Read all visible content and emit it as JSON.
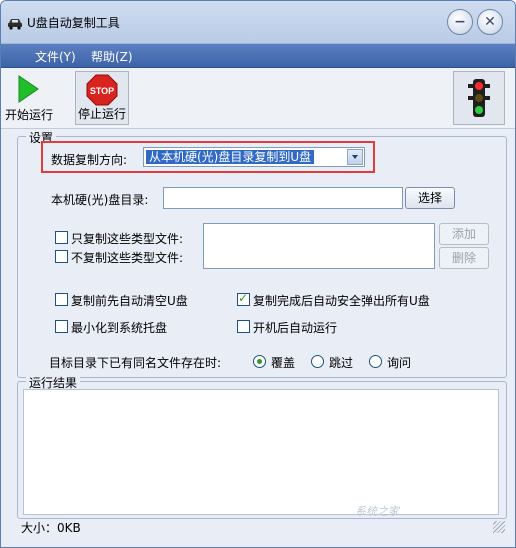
{
  "window": {
    "title": "U盘自动复制工具",
    "min_symbol": "−",
    "close_symbol": "✕"
  },
  "menu": [
    {
      "label": "文件(Y)"
    },
    {
      "label": "帮助(Z)"
    }
  ],
  "toolbar": {
    "start_label": "开始运行",
    "stop_label": "停止运行",
    "stop_sign_text": "STOP"
  },
  "settings": {
    "legend": "设置",
    "direction_label": "数据复制方向:",
    "direction_value": "从本机硬(光)盘目录复制到U盘",
    "local_dir_label": "本机硬(光)盘目录:",
    "local_dir_value": "",
    "choose_button": "选择",
    "only_copy_label": "只复制这些类型文件:",
    "no_copy_label": "不复制这些类型文件:",
    "add_button": "添加",
    "delete_button": "删除",
    "clear_usb_label": "复制前先自动清空U盘",
    "clear_usb_checked": false,
    "eject_label": "复制完成后自动安全弹出所有U盘",
    "eject_checked": true,
    "minimize_label": "最小化到系统托盘",
    "minimize_checked": false,
    "autostart_label": "开机后自动运行",
    "autostart_checked": false,
    "conflict_label": "目标目录下已有同名文件存在时:",
    "conflict_options": [
      "覆盖",
      "跳过",
      "询问"
    ],
    "conflict_selected": "覆盖"
  },
  "results": {
    "legend": "运行结果"
  },
  "status": {
    "size_text": "大小：0KB"
  },
  "watermark": "系统之家",
  "colors": {
    "menubar": "#3d63a8",
    "highlight": "#e23b3b",
    "selection": "#316ac5"
  }
}
